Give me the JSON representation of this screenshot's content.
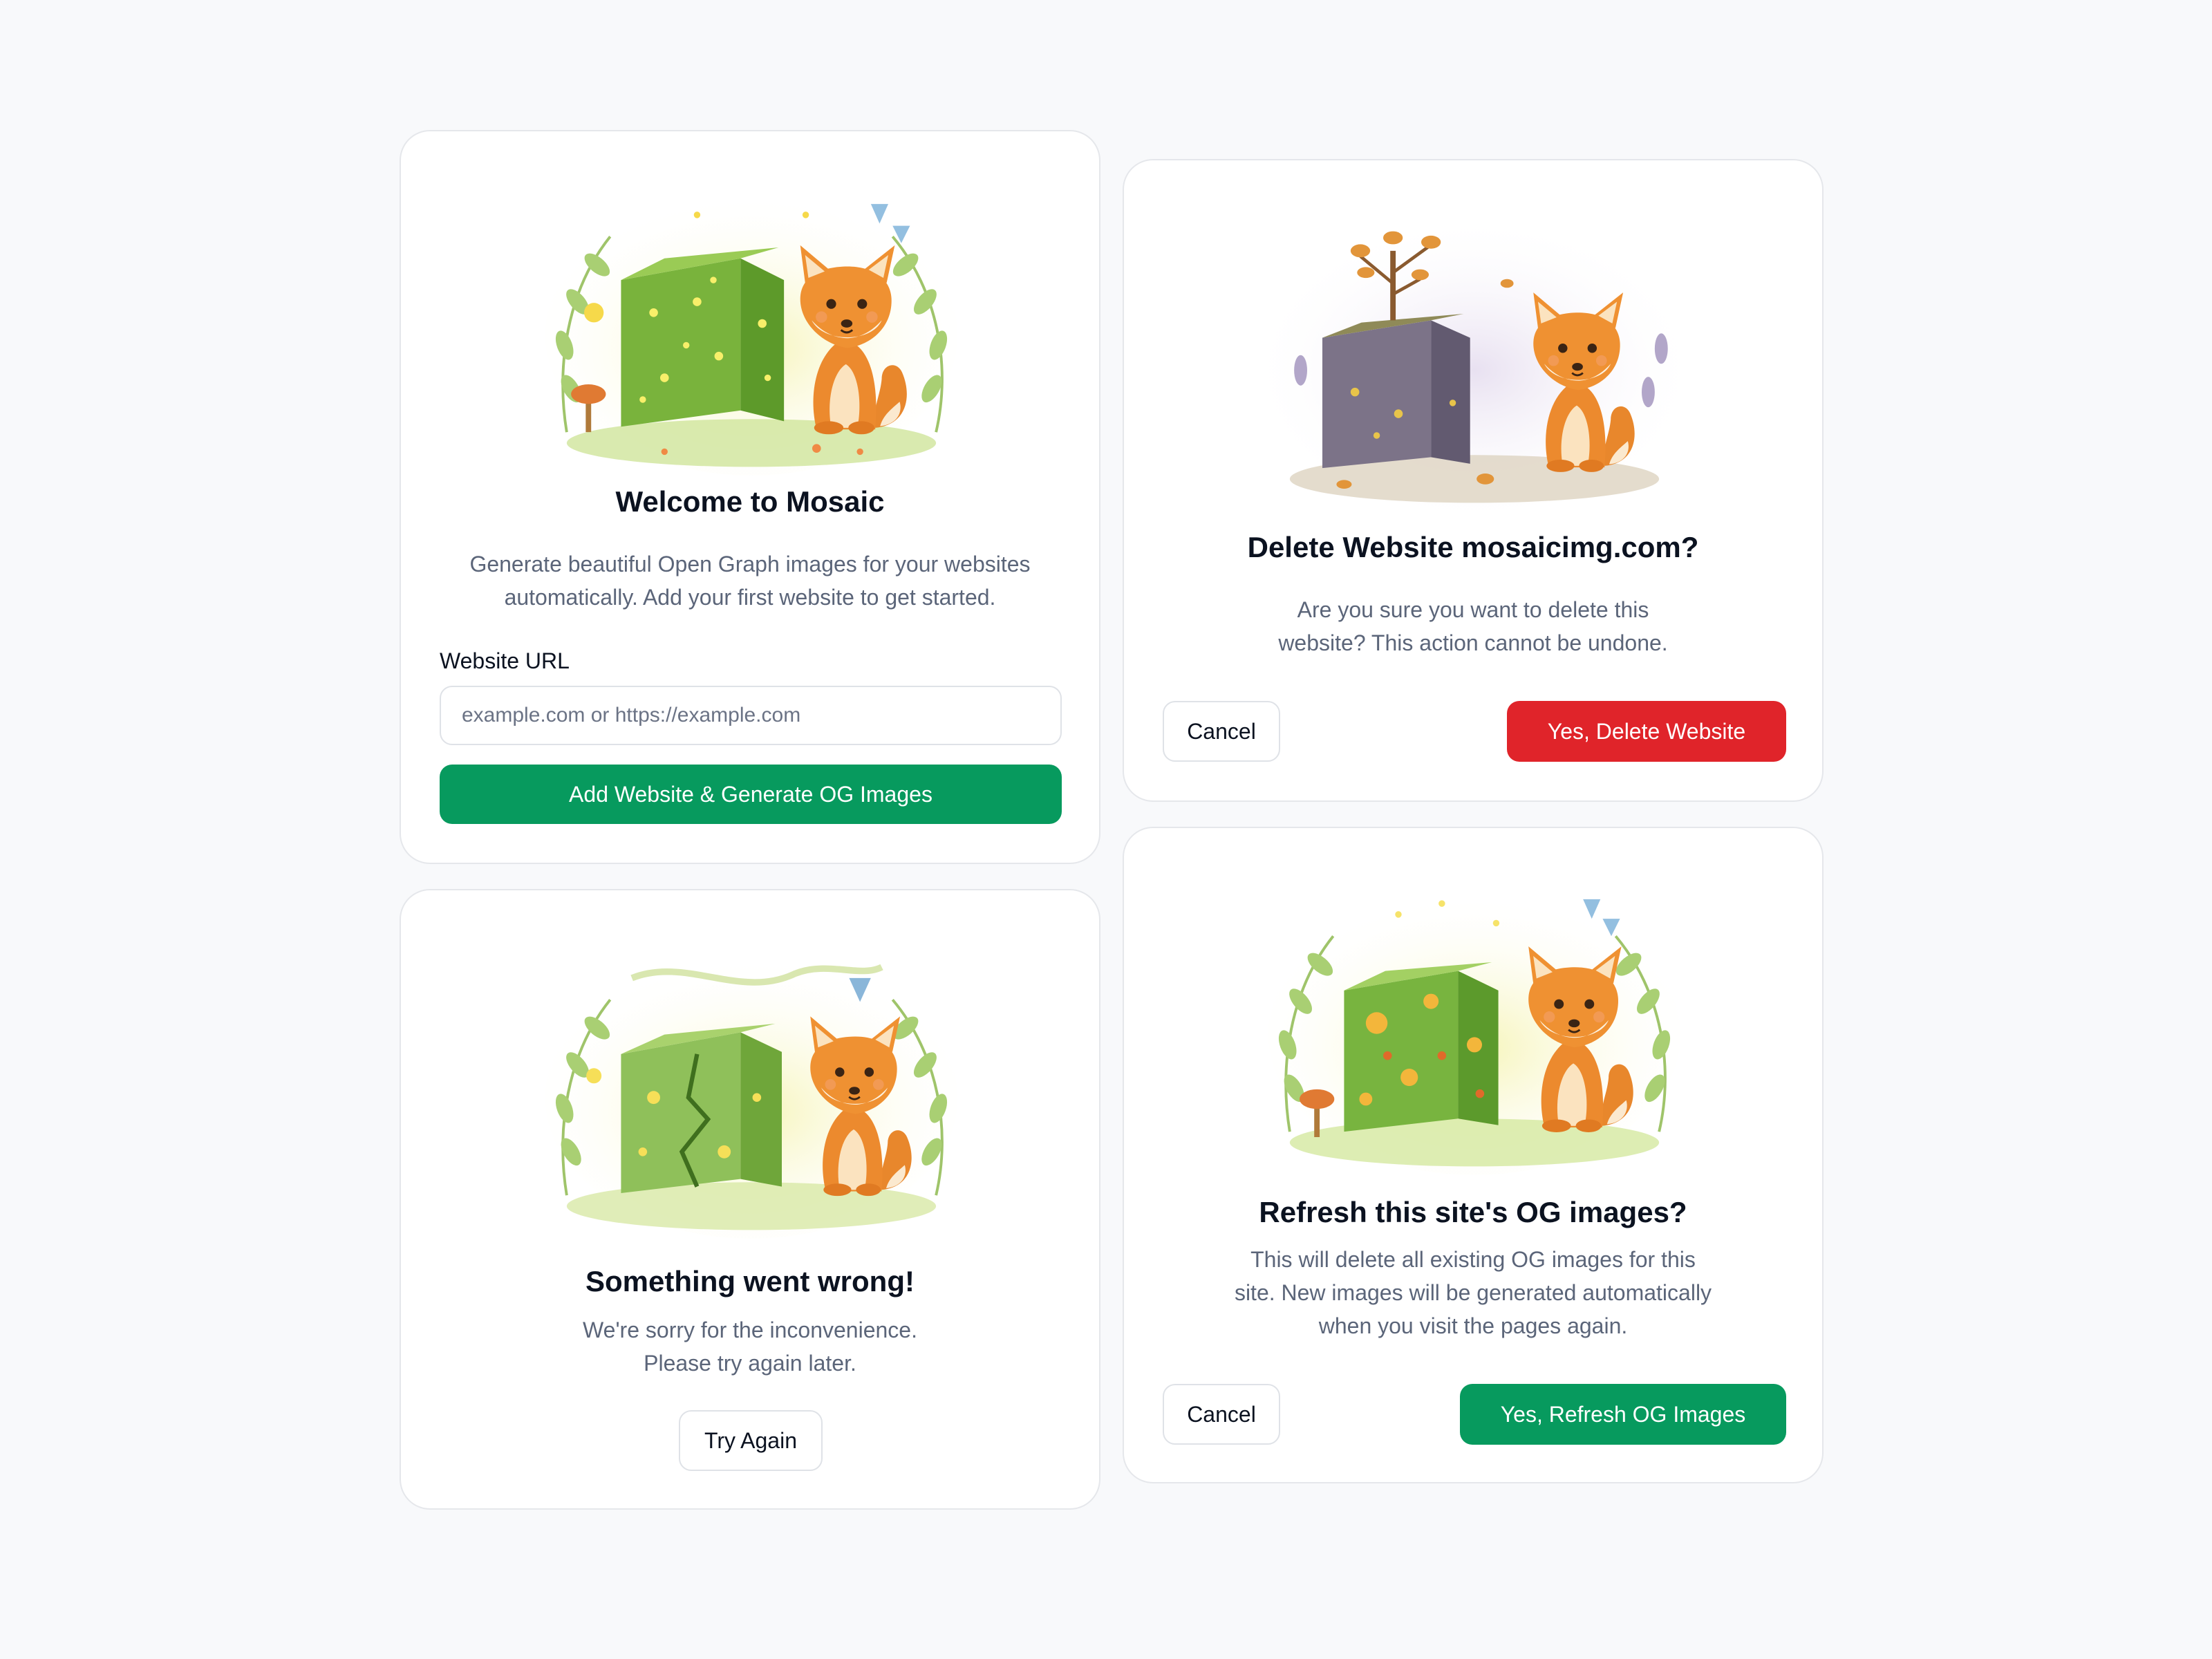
{
  "colors": {
    "primary": "#079a5e",
    "danger": "#e0242a",
    "page_background": "#f8f9fb",
    "card_border": "#e5e7eb",
    "muted_text": "#5b6579"
  },
  "welcome_card": {
    "illustration": "fox-beside-glowing-moss-cube",
    "title": "Welcome to Mosaic",
    "description": "Generate beautiful Open Graph images for your websites automatically. Add your first website to get started.",
    "url_label": "Website URL",
    "url_value": "",
    "url_placeholder": "example.com or https://example.com",
    "submit_label": "Add Website & Generate OG Images"
  },
  "error_card": {
    "illustration": "sad-fox-beside-cracked-moss-cube",
    "title": "Something went wrong!",
    "description_line1": "We're sorry for the inconvenience.",
    "description_line2": "Please try again later.",
    "retry_label": "Try Again"
  },
  "delete_card": {
    "illustration": "fox-beside-withered-cube-autumn-tree",
    "title": "Delete Website mosaicimg.com?",
    "description_line1": "Are you sure you want to delete this",
    "description_line2": "website? This action cannot be undone.",
    "cancel_label": "Cancel",
    "confirm_label": "Yes, Delete Website"
  },
  "refresh_card": {
    "illustration": "fox-sniffing-flowering-moss-cube",
    "title": "Refresh this site's OG images?",
    "description_line1": "This will delete all existing OG images for this",
    "description_line2": "site. New images will be generated automatically",
    "description_line3": "when you visit the pages again.",
    "cancel_label": "Cancel",
    "confirm_label": "Yes, Refresh OG Images"
  }
}
